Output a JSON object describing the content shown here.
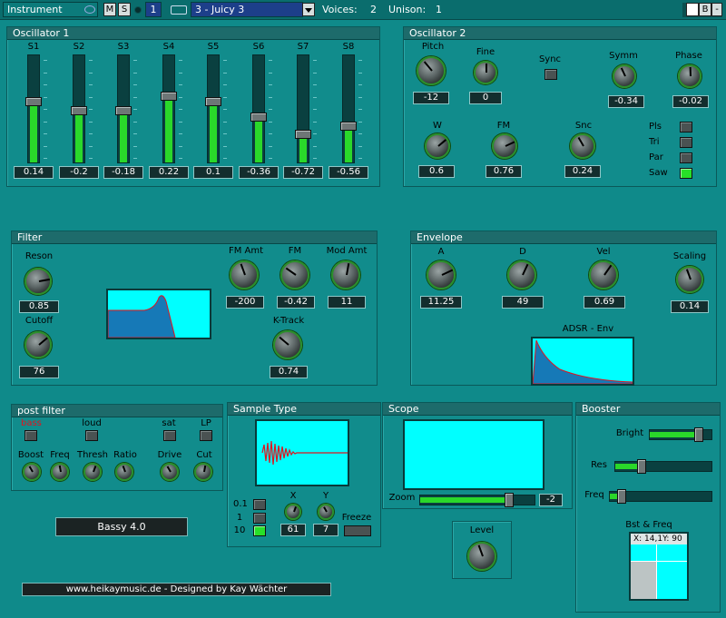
{
  "topbar": {
    "instrument_label": "Instrument",
    "m_label": "M",
    "s_label": "S",
    "channel": "1",
    "preset": "3 - Juicy 3",
    "voices_label": "Voices:",
    "voices_value": "2",
    "unison_label": "Unison:",
    "unison_value": "1",
    "b_label": "B",
    "close_label": "-"
  },
  "osc1": {
    "title": "Oscillator 1",
    "sliders": [
      {
        "label": "S1",
        "value": "0.14",
        "level": 0.57
      },
      {
        "label": "S2",
        "value": "-0.2",
        "level": 0.48
      },
      {
        "label": "S3",
        "value": "-0.18",
        "level": 0.48
      },
      {
        "label": "S4",
        "value": "0.22",
        "level": 0.62
      },
      {
        "label": "S5",
        "value": "0.1",
        "level": 0.57
      },
      {
        "label": "S6",
        "value": "-0.36",
        "level": 0.42
      },
      {
        "label": "S7",
        "value": "-0.72",
        "level": 0.26
      },
      {
        "label": "S8",
        "value": "-0.56",
        "level": 0.34
      }
    ]
  },
  "osc2": {
    "title": "Oscillator 2",
    "pitch_label": "Pitch",
    "pitch_value": "-12",
    "fine_label": "Fine",
    "fine_value": "0",
    "sync_label": "Sync",
    "symm_label": "Symm",
    "symm_value": "-0.34",
    "phase_label": "Phase",
    "phase_value": "-0.02",
    "w_label": "W",
    "w_value": "0.6",
    "fm_label": "FM",
    "fm_value": "0.76",
    "snc_label": "Snc",
    "snc_value": "0.24",
    "waves": [
      {
        "label": "Pls",
        "on": false
      },
      {
        "label": "Tri",
        "on": false
      },
      {
        "label": "Par",
        "on": false
      },
      {
        "label": "Saw",
        "on": true
      }
    ]
  },
  "filter": {
    "title": "Filter",
    "reson_label": "Reson",
    "reson_value": "0.85",
    "cutoff_label": "Cutoff",
    "cutoff_value": "76",
    "fmamt_label": "FM Amt",
    "fmamt_value": "-200",
    "fm_label": "FM",
    "fm_value": "-0.42",
    "modamt_label": "Mod Amt",
    "modamt_value": "11",
    "ktrack_label": "K-Track",
    "ktrack_value": "0.74"
  },
  "envelope": {
    "title": "Envelope",
    "a_label": "A",
    "a_value": "11.25",
    "d_label": "D",
    "d_value": "49",
    "vel_label": "Vel",
    "vel_value": "0.69",
    "scaling_label": "Scaling",
    "scaling_value": "0.14",
    "graph_label": "ADSR - Env"
  },
  "postfilter": {
    "title": "post filter",
    "bass_label": "bass",
    "loud_label": "loud",
    "sat_label": "sat",
    "lp_label": "LP",
    "boost_label": "Boost",
    "freq_label": "Freq",
    "thresh_label": "Thresh",
    "ratio_label": "Ratio",
    "drive_label": "Drive",
    "cut_label": "Cut",
    "preset_name": "Bassy 4.0"
  },
  "sampletype": {
    "title": "Sample Type",
    "opt1_label": "0.1",
    "opt2_label": "1",
    "opt3_label": "10",
    "x_label": "X",
    "x_value": "61",
    "y_label": "Y",
    "y_value": "7",
    "freeze_label": "Freeze"
  },
  "scope": {
    "title": "Scope",
    "zoom_label": "Zoom",
    "zoom_value": "-2",
    "zoom_level": 0.78
  },
  "level": {
    "label": "Level"
  },
  "booster": {
    "title": "Booster",
    "bright_label": "Bright",
    "bright_level": 0.8,
    "res_label": "Res",
    "res_level": 0.27,
    "freq_label": "Freq",
    "freq_level": 0.12,
    "graph_label": "Bst & Freq",
    "readout": "X: 14,1Y: 90"
  },
  "footer": {
    "credit": "www.heikaymusic.de - Designed by Kay Wächter"
  },
  "colors": {
    "background": "#0f8a8a",
    "display": "#00ffff",
    "led_on": "#28e028",
    "wave_red": "#e0141e"
  }
}
